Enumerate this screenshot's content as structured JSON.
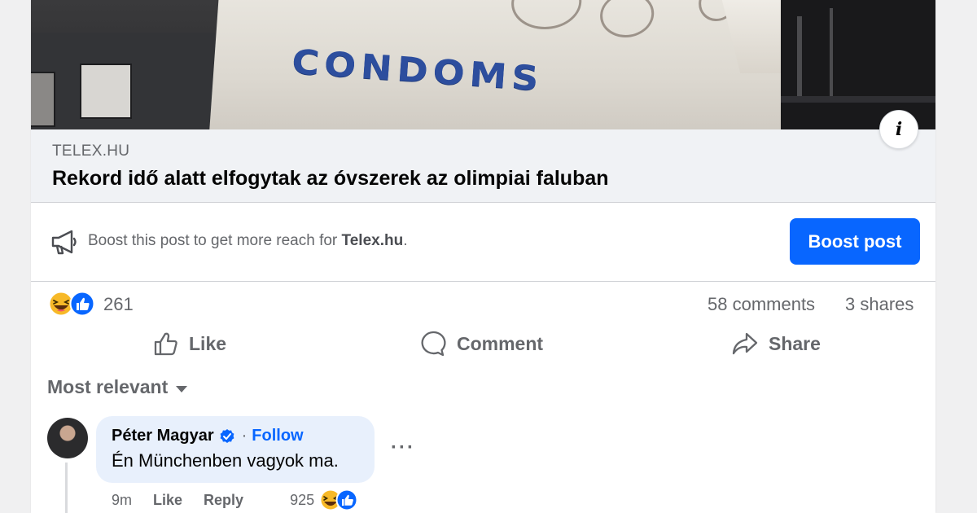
{
  "preview": {
    "image_text": "CONDOMS",
    "info_icon": "info-icon"
  },
  "link": {
    "domain": "TELEX.HU",
    "title": "Rekord idő alatt elfogytak az óvszerek az olimpiai faluban"
  },
  "boost": {
    "text_prefix": "Boost this post to get more reach for ",
    "page_name": "Telex.hu",
    "text_suffix": ".",
    "button_label": "Boost post",
    "icon": "megaphone-icon"
  },
  "stats": {
    "reactions": [
      "haha",
      "like"
    ],
    "reaction_count": "261",
    "comments": "58 comments",
    "shares": "3 shares"
  },
  "actions": {
    "like": "Like",
    "comment": "Comment",
    "share": "Share"
  },
  "comments": {
    "sort_label": "Most relevant",
    "items": [
      {
        "author": "Péter Magyar",
        "verified": true,
        "separator": "·",
        "follow": "Follow",
        "text": "Én Münchenben vagyok ma.",
        "time": "9m",
        "like": "Like",
        "reply": "Reply",
        "reaction_count": "925",
        "more": "···"
      }
    ]
  },
  "colors": {
    "accent": "#0866ff",
    "secondary_text": "#65676b",
    "bubble_bg": "#e8f0fc",
    "link_meta_bg": "#f0f2f5"
  }
}
